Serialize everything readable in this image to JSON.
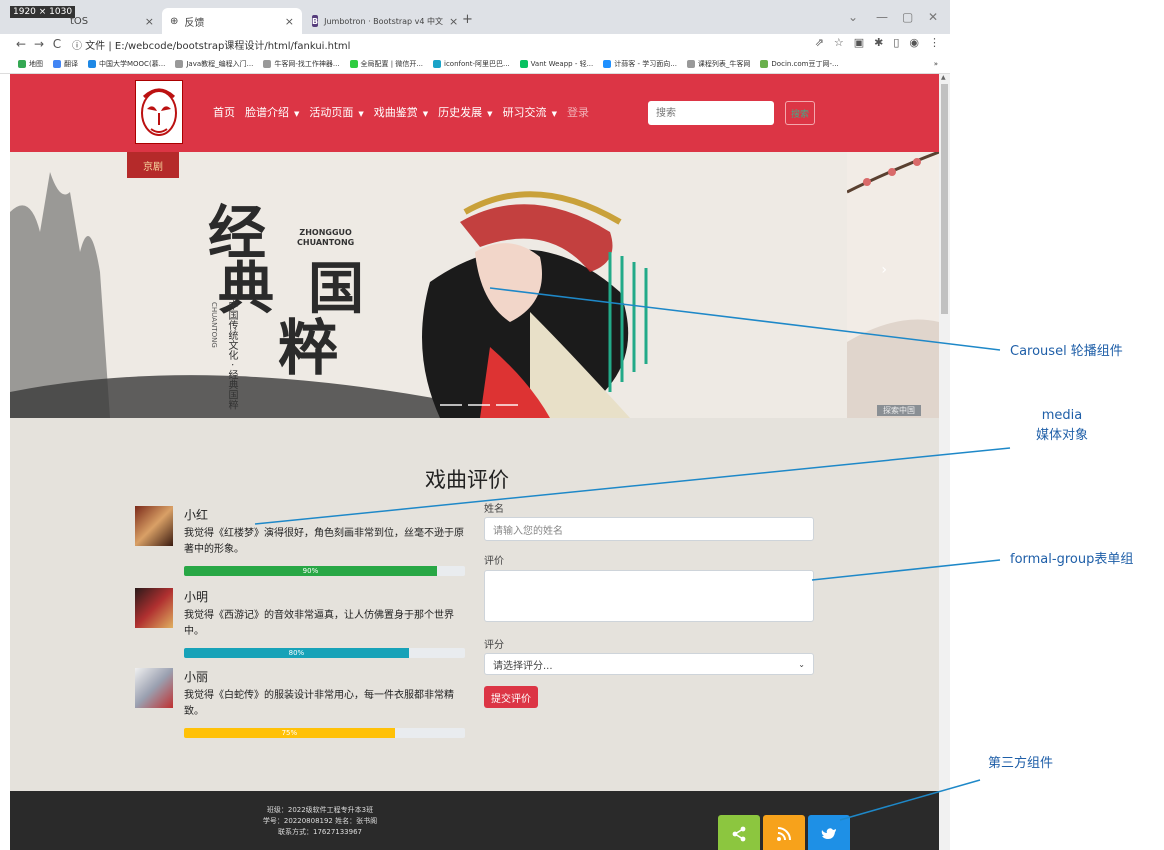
{
  "browser": {
    "size_badge": "1920 × 1030",
    "tabs": [
      {
        "label": "tOS",
        "close": "×"
      },
      {
        "label": "反馈",
        "close": "×"
      },
      {
        "label": "Jumbotron · Bootstrap v4 中文",
        "close": "×"
      }
    ],
    "new_tab": "+",
    "window_controls": [
      "⌄",
      "—",
      "▢",
      "✕"
    ],
    "nav": {
      "back": "←",
      "forward": "→",
      "reload": "C"
    },
    "url": "ⓘ 文件 | E:/webcode/bootstrap课程设计/html/fankui.html",
    "addr_icons": [
      "⇗",
      "☆",
      "▣",
      "✱",
      "▯",
      "◉",
      "⋮"
    ],
    "bookmarks": [
      {
        "label": "地图",
        "color": "#34a853"
      },
      {
        "label": "翻译",
        "color": "#4285f4"
      },
      {
        "label": "中国大学MOOC(慕...",
        "color": "#1e88e5"
      },
      {
        "label": "Java教程_编程入门...",
        "color": "#999999"
      },
      {
        "label": "牛客网-找工作神器...",
        "color": "#999999"
      },
      {
        "label": "全局配置 | 微信开...",
        "color": "#2ecc40"
      },
      {
        "label": "iconfont-阿里巴巴...",
        "color": "#1aa3c8"
      },
      {
        "label": "Vant Weapp - 轻...",
        "color": "#07c160"
      },
      {
        "label": "计蒜客 - 学习面向...",
        "color": "#1e90ff"
      },
      {
        "label": "课程列表_牛客网",
        "color": "#999999"
      },
      {
        "label": "Docin.com豆丁网-...",
        "color": "#6ab04c"
      }
    ],
    "bookmarks_more": "»"
  },
  "navbar": {
    "items": [
      {
        "label": "首页",
        "caret": ""
      },
      {
        "label": "脸谱介绍",
        "caret": "▼"
      },
      {
        "label": "活动页面",
        "caret": "▼"
      },
      {
        "label": "戏曲鉴赏",
        "caret": "▼"
      },
      {
        "label": "历史发展",
        "caret": "▼"
      },
      {
        "label": "研习交流",
        "caret": "▼"
      }
    ],
    "login": "登录",
    "search_placeholder": "搜索",
    "search_button": "搜索"
  },
  "carousel": {
    "tag": "京剧",
    "title_chars": [
      "经",
      "典",
      "国",
      "粹"
    ],
    "english": "ZHONGGUO\nCHUANTONG",
    "vertical_cn": "中国传统文化 · 经典国粹",
    "vertical_en": "CHUANTONG",
    "side_label": "探索中国",
    "next": "›"
  },
  "reviews": {
    "title": "戏曲评价",
    "items": [
      {
        "name": "小红",
        "text": "我觉得《红楼梦》演得很好，角色刻画非常到位，丝毫不逊于原著中的形象。",
        "progress": 90,
        "label": "90%",
        "color": "#28a745"
      },
      {
        "name": "小明",
        "text": "我觉得《西游记》的音效非常逼真，让人仿佛置身于那个世界中。",
        "progress": 80,
        "label": "80%",
        "color": "#17a2b8"
      },
      {
        "name": "小丽",
        "text": "我觉得《白蛇传》的服装设计非常用心，每一件衣服都非常精致。",
        "progress": 75,
        "label": "75%",
        "color": "#ffc107"
      }
    ],
    "form": {
      "name_label": "姓名",
      "name_placeholder": "请输入您的姓名",
      "comment_label": "评价",
      "rating_label": "评分",
      "rating_placeholder": "请选择评分...",
      "submit": "提交评价"
    }
  },
  "footer": {
    "lines": [
      "班级：2022级软件工程专升本3班",
      "学号：20220808192 姓名：张书阁",
      "联系方式：17627133967"
    ],
    "social": [
      {
        "icon": "share-icon",
        "glyph": "<",
        "color": "#8cc63f"
      },
      {
        "icon": "rss-icon",
        "glyph": "》",
        "color": "#f7a21b"
      },
      {
        "icon": "twitter-icon",
        "glyph": "✦",
        "color": "#1e90e6"
      }
    ]
  },
  "annotations": [
    {
      "label": "Carousel 轮播组件"
    },
    {
      "label": "media\n媒体对象"
    },
    {
      "label": "formal-group表单组"
    },
    {
      "label": "第三方组件"
    }
  ]
}
